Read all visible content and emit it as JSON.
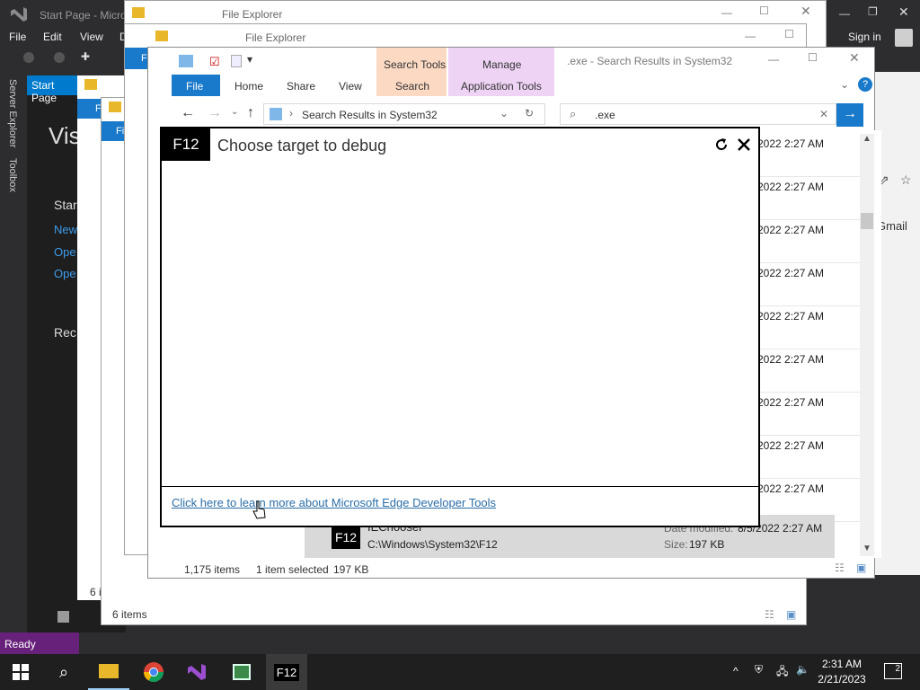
{
  "vs": {
    "title": "Start Page - Micro",
    "menu": [
      "File",
      "Edit",
      "View",
      "D"
    ],
    "sign_in": "Sign in",
    "side_tabs": [
      "Server Explorer",
      "Toolbox"
    ],
    "doc_tab": "Start Page",
    "heading": "Vis",
    "start": "Star",
    "links": [
      "New",
      "Ope",
      "Ope"
    ],
    "recent": "Rec",
    "status": "Ready",
    "gmail": "Gmail"
  },
  "back_windows": {
    "title": "File Explorer",
    "file_tab": "File",
    "count1": "6 i",
    "count2": "6 i",
    "count3": "6 i",
    "items": "6 items"
  },
  "explorer": {
    "title": ".exe - Search Results in System32",
    "context_search": "Search Tools",
    "context_manage": "Manage",
    "tabs": [
      "File",
      "Home",
      "Share",
      "View",
      "Search",
      "Application Tools"
    ],
    "address": "Search Results in System32",
    "search_value": ".exe",
    "date_rows": [
      "2022 2:27 AM",
      "2022 2:27 AM",
      "2022 2:27 AM",
      "2022 2:27 AM",
      "2022 2:27 AM",
      "2022 2:27 AM",
      "2022 2:27 AM",
      "2022 2:27 AM",
      "2022 2:27 AM"
    ],
    "selected": {
      "name": "IEChooser",
      "path": "C:\\Windows\\System32\\F12",
      "date_label": "Date modified:",
      "date_value": "8/5/2022 2:27 AM",
      "size_label": "Size:",
      "size_value": "197 KB",
      "icon_text": "F12"
    },
    "status_count": "1,175 items",
    "status_selected": "1 item selected",
    "status_size": "197 KB"
  },
  "f12": {
    "logo": "F12",
    "title": "Choose target to debug",
    "link": "Click here to learn more about Microsoft Edge Developer Tools"
  },
  "taskbar": {
    "time": "2:31 AM",
    "date": "2/21/2023",
    "notif_count": "2",
    "f12_label": "F12"
  }
}
